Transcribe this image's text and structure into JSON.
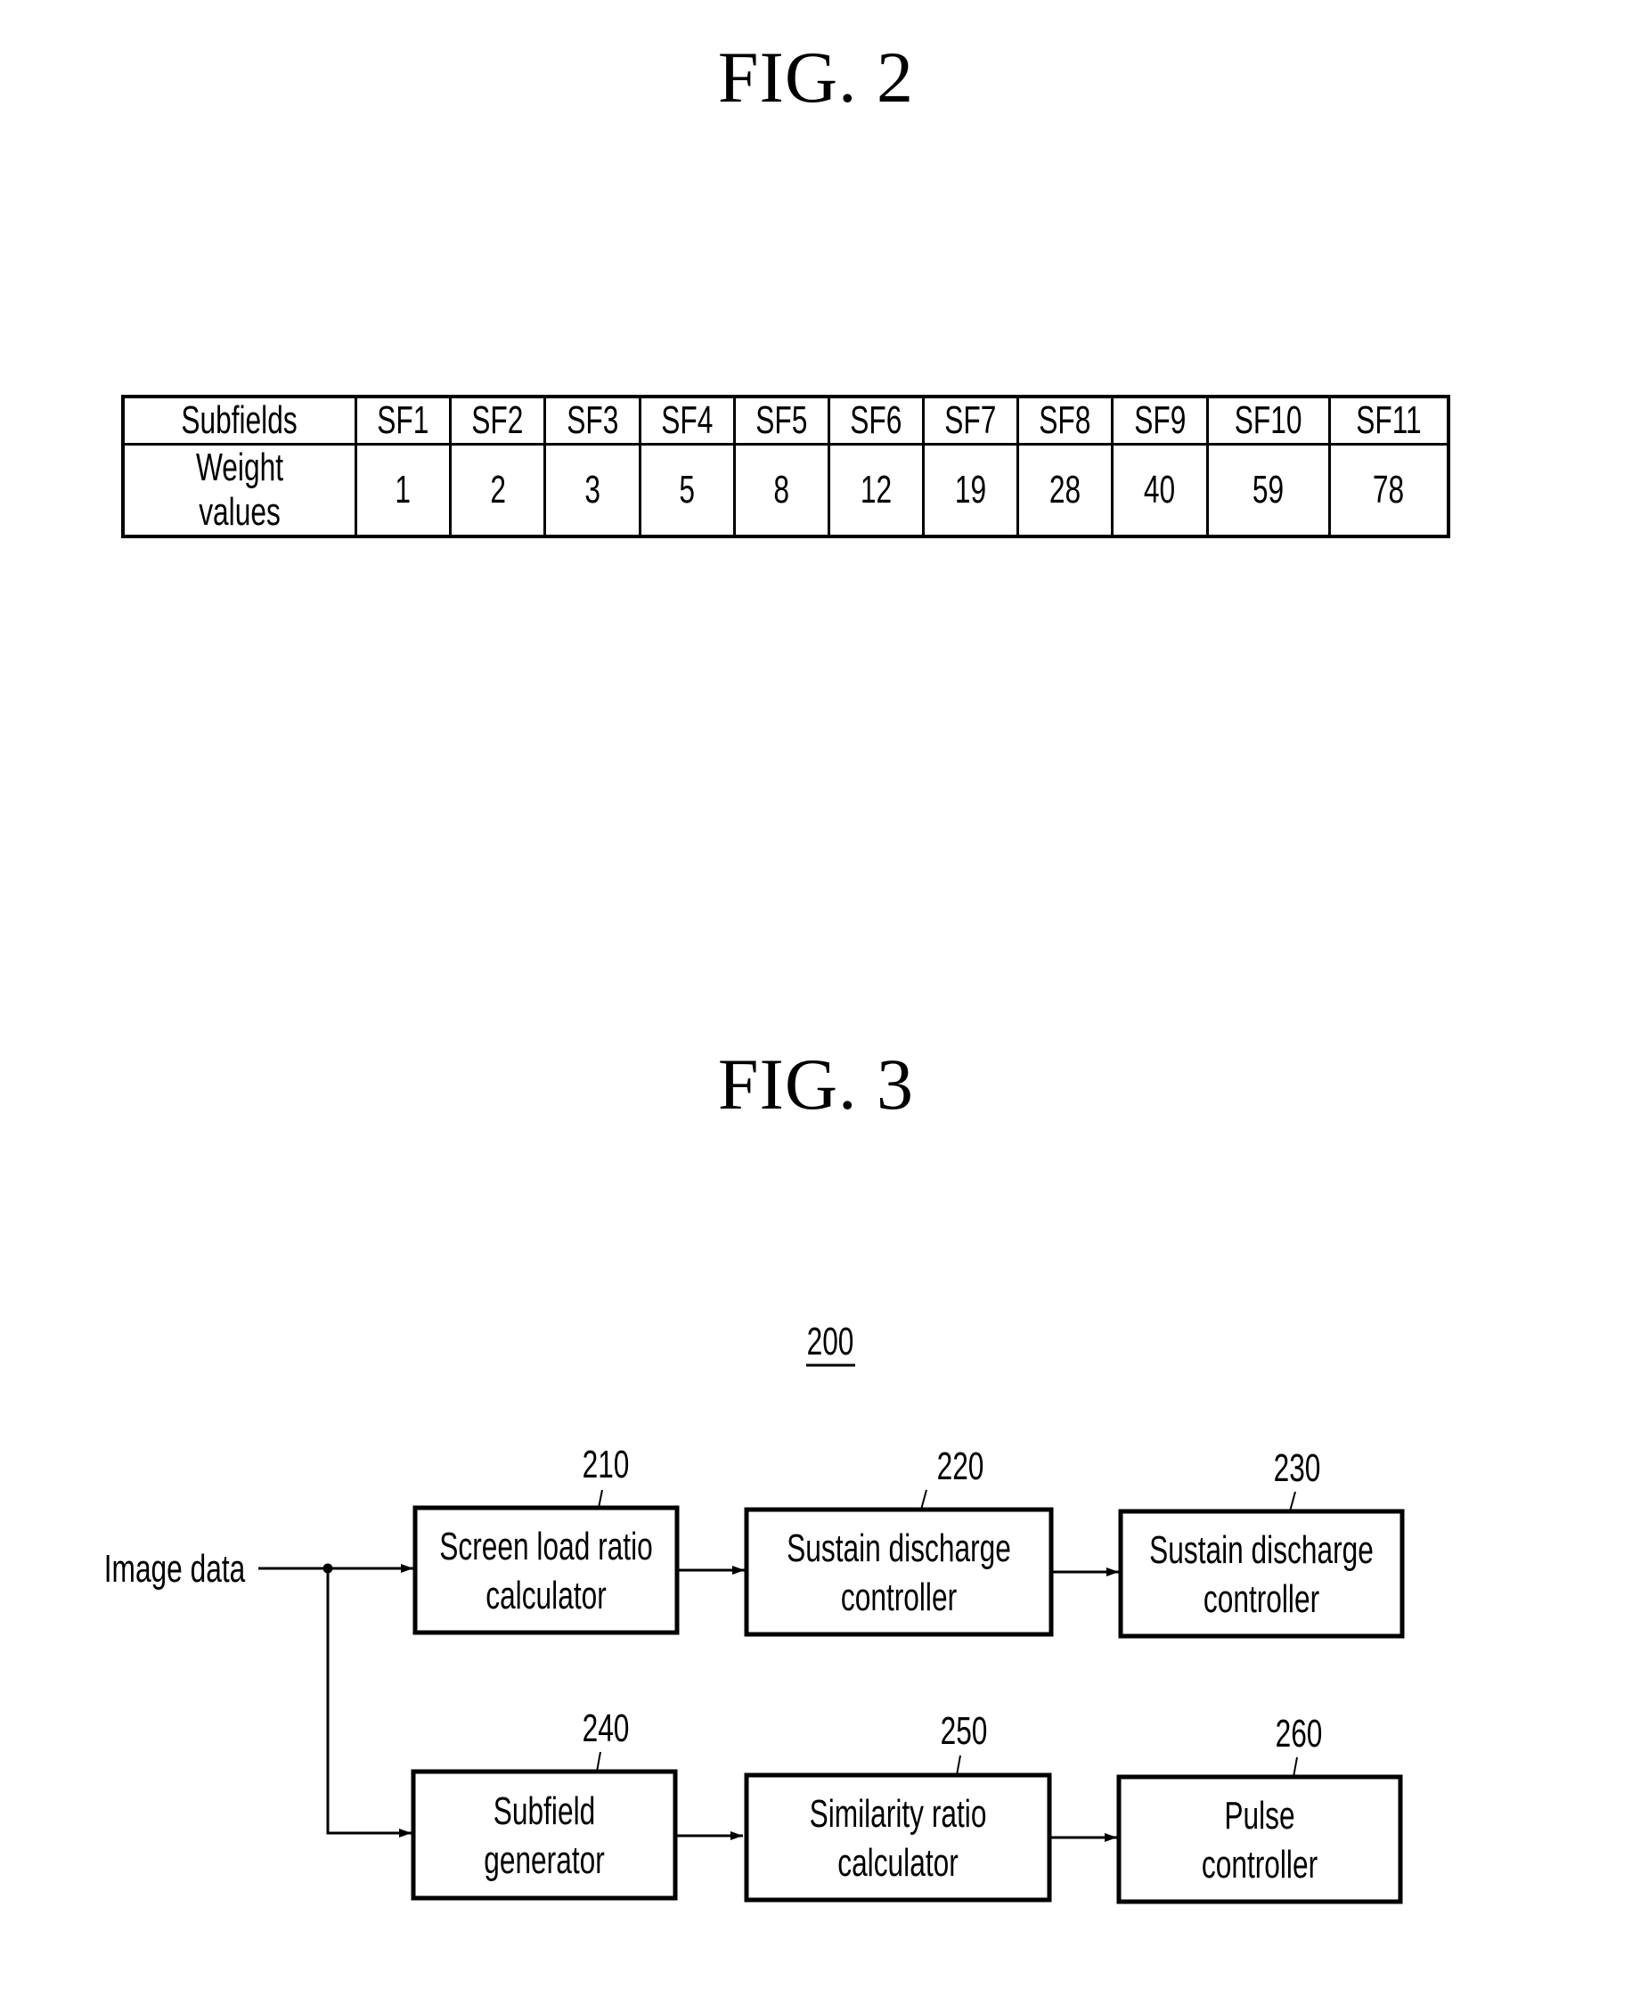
{
  "fig2": {
    "title": "FIG. 2",
    "table": {
      "row_headers": [
        "Subfields",
        "Weight values"
      ],
      "subfields": [
        "SF1",
        "SF2",
        "SF3",
        "SF4",
        "SF5",
        "SF6",
        "SF7",
        "SF8",
        "SF9",
        "SF10",
        "SF11"
      ],
      "weights": [
        "1",
        "2",
        "3",
        "5",
        "8",
        "12",
        "19",
        "28",
        "40",
        "59",
        "78"
      ]
    }
  },
  "fig3": {
    "title": "FIG. 3",
    "system_ref": "200",
    "input_label": "Image data",
    "blocks": [
      {
        "ref": "210",
        "line1": "Screen load ratio",
        "line2": "calculator"
      },
      {
        "ref": "220",
        "line1": "Sustain discharge",
        "line2": "controller"
      },
      {
        "ref": "230",
        "line1": "Sustain discharge",
        "line2": "controller"
      },
      {
        "ref": "240",
        "line1": "Subfield",
        "line2": "generator"
      },
      {
        "ref": "250",
        "line1": "Similarity ratio",
        "line2": "calculator"
      },
      {
        "ref": "260",
        "line1": "Pulse",
        "line2": "controller"
      }
    ]
  }
}
